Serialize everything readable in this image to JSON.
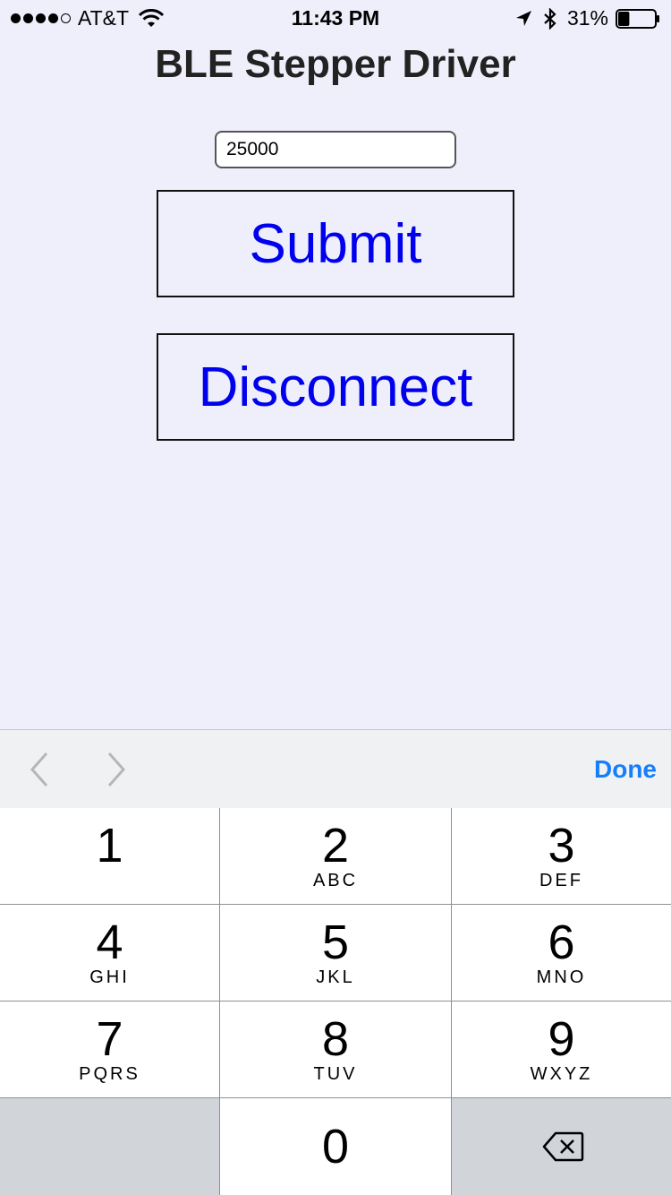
{
  "status_bar": {
    "carrier": "AT&T",
    "time": "11:43 PM",
    "battery": "31%",
    "battery_level": 0.31,
    "icons": [
      "signal-dots",
      "wifi-icon",
      "location-arrow-icon",
      "bluetooth-icon",
      "battery-icon"
    ]
  },
  "app": {
    "title": "BLE Stepper Driver",
    "input_value": "25000",
    "submit_label": "Submit",
    "disconnect_label": "Disconnect"
  },
  "accessory": {
    "done_label": "Done",
    "icons": [
      "chevron-left-icon",
      "chevron-right-icon"
    ]
  },
  "keypad": {
    "keys": [
      {
        "digit": "1",
        "letters": ""
      },
      {
        "digit": "2",
        "letters": "ABC"
      },
      {
        "digit": "3",
        "letters": "DEF"
      },
      {
        "digit": "4",
        "letters": "GHI"
      },
      {
        "digit": "5",
        "letters": "JKL"
      },
      {
        "digit": "6",
        "letters": "MNO"
      },
      {
        "digit": "7",
        "letters": "PQRS"
      },
      {
        "digit": "8",
        "letters": "TUV"
      },
      {
        "digit": "9",
        "letters": "WXYZ"
      },
      {
        "digit": "0",
        "letters": ""
      }
    ],
    "colors": {
      "key": "#ffffff",
      "dark_key": "#d1d4d9",
      "done": "#157efb",
      "button_text": "#0000ee"
    }
  }
}
